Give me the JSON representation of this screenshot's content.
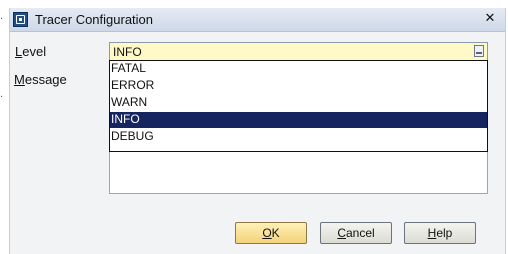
{
  "window": {
    "title": "Tracer Configuration",
    "close_glyph": "✕"
  },
  "form": {
    "level_label_mnemonic": "L",
    "level_label_rest": "evel",
    "message_label_mnemonic": "M",
    "message_label_rest": "essage",
    "level_value": "INFO"
  },
  "dropdown": {
    "options": [
      {
        "label": "FATAL",
        "selected": false
      },
      {
        "label": "ERROR",
        "selected": false
      },
      {
        "label": "WARN",
        "selected": false
      },
      {
        "label": "INFO",
        "selected": true
      },
      {
        "label": "DEBUG",
        "selected": false
      }
    ]
  },
  "buttons": {
    "ok_mnemonic": "O",
    "ok_rest": "K",
    "cancel_mnemonic": "C",
    "cancel_rest": "ancel",
    "help_mnemonic": "H",
    "help_rest": "elp"
  },
  "colors": {
    "selected_option_bg": "#16255f",
    "level_field_bg": "#fff9c8",
    "primary_button_bg": "#f3d27a"
  },
  "icons": {
    "app": "tracer-app-icon",
    "close": "close-icon",
    "dropdown": "dropdown-icon"
  }
}
